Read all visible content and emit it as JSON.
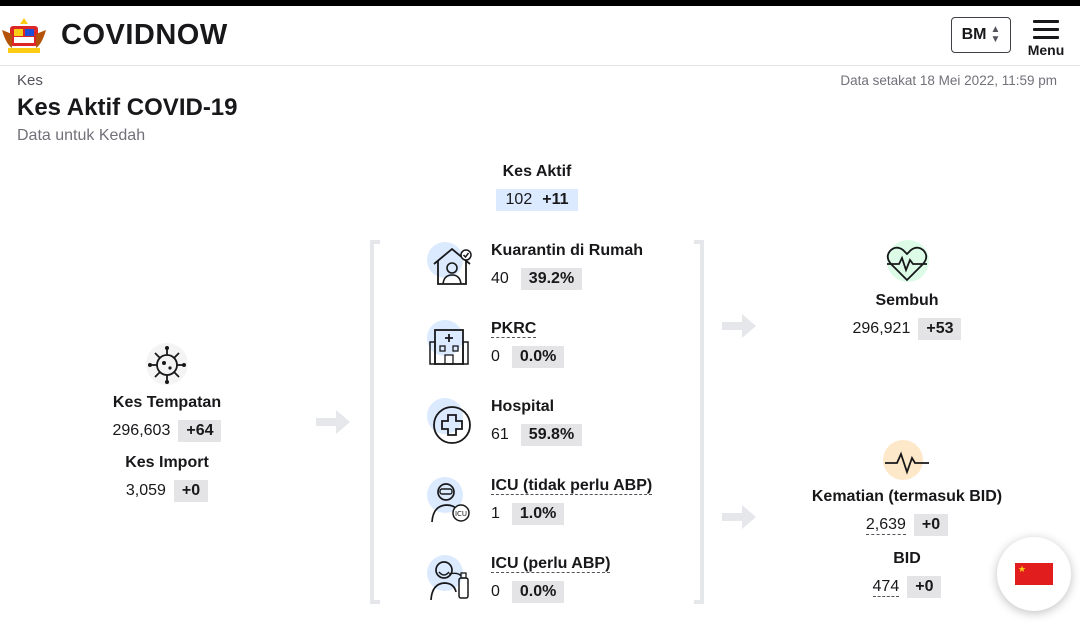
{
  "header": {
    "brand": "COVIDNOW",
    "language": "BM",
    "menu_label": "Menu"
  },
  "page": {
    "breadcrumb": "Kes",
    "title": "Kes Aktif COVID-19",
    "subtitle": "Data untuk Kedah",
    "updated": "Data setakat 18 Mei 2022, 11:59 pm"
  },
  "kes_aktif": {
    "label": "Kes Aktif",
    "value": "102",
    "delta": "+11"
  },
  "sources": {
    "tempatan": {
      "label": "Kes Tempatan",
      "value": "296,603",
      "delta": "+64",
      "icon": "virus-icon"
    },
    "import": {
      "label": "Kes Import",
      "value": "3,059",
      "delta": "+0"
    }
  },
  "active_breakdown": [
    {
      "label": "Kuarantin di Rumah",
      "value": "40",
      "pct": "39.2%",
      "icon": "home-quarantine-icon"
    },
    {
      "label": "PKRC",
      "value": "0",
      "pct": "0.0%",
      "icon": "quarantine-center-icon"
    },
    {
      "label": "Hospital",
      "value": "61",
      "pct": "59.8%",
      "icon": "hospital-cross-icon"
    },
    {
      "label": "ICU (tidak perlu ABP)",
      "value": "1",
      "pct": "1.0%",
      "icon": "icu-patient-icon"
    },
    {
      "label": "ICU (perlu ABP)",
      "value": "0",
      "pct": "0.0%",
      "icon": "ventilator-patient-icon"
    }
  ],
  "outcomes": {
    "sembuh": {
      "label": "Sembuh",
      "value": "296,921",
      "delta": "+53",
      "icon": "heart-pulse-icon"
    },
    "kematian": {
      "label": "Kematian (termasuk BID)",
      "value": "2,639",
      "delta": "+0",
      "icon": "pulse-line-icon"
    },
    "bid": {
      "label": "BID",
      "value": "474",
      "delta": "+0"
    }
  },
  "colors": {
    "blue_badge": "#dbeafe",
    "grey_badge": "#e4e4e7",
    "green_circle": "#dcfce7",
    "orange_circle": "#fde9c9"
  }
}
